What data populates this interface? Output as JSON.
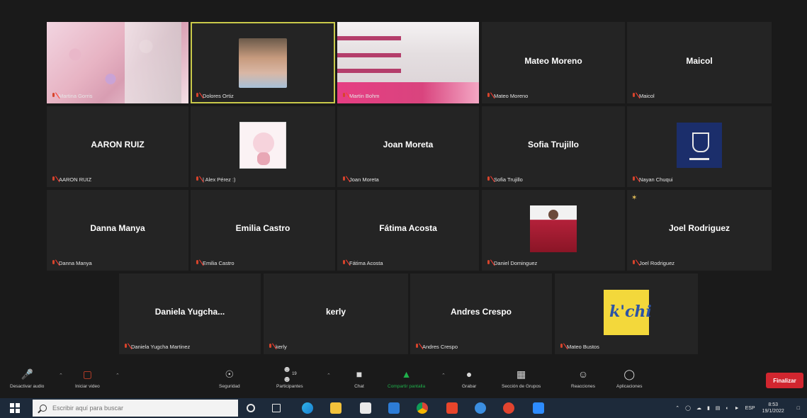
{
  "participants": [
    {
      "name": "Martina Gorris",
      "big": ""
    },
    {
      "name": "Dolores Ortiz",
      "big": ""
    },
    {
      "name": "Martin Bohm",
      "big": ""
    },
    {
      "name": "Mateo Moreno",
      "big": "Mateo Moreno"
    },
    {
      "name": "Maicol",
      "big": "Maicol"
    },
    {
      "name": "AARON RUIZ",
      "big": "AARON RUIZ"
    },
    {
      "name": "| Alex Pérez :)",
      "big": ""
    },
    {
      "name": "Joan Moreta",
      "big": "Joan Moreta"
    },
    {
      "name": "Sofia Trujillo",
      "big": "Sofia Trujillo"
    },
    {
      "name": "Nayan Chuqui",
      "big": ""
    },
    {
      "name": "Danna Manya",
      "big": "Danna Manya"
    },
    {
      "name": "Emilia Castro",
      "big": "Emilia Castro"
    },
    {
      "name": "Fátima Acosta",
      "big": "Fátima Acosta"
    },
    {
      "name": "Daniel Dominguez",
      "big": ""
    },
    {
      "name": "Joel Rodriguez",
      "big": "Joel Rodriguez"
    },
    {
      "name": "Daniela Yugcha Martinez",
      "big": "Daniela Yugcha..."
    },
    {
      "name": "kerly",
      "big": "kerly"
    },
    {
      "name": "Andres Crespo",
      "big": "Andres Crespo"
    },
    {
      "name": "Mateo Bustos",
      "big": ""
    }
  ],
  "toolbar": {
    "mute": "Desactivar audio",
    "video": "Iniciar video",
    "security": "Seguridad",
    "participants": "Participantes",
    "participants_count": "19",
    "chat": "Chat",
    "share": "Compartir pantalla",
    "record": "Grabar",
    "breakout": "Sección de Grupos",
    "reactions": "Reacciones",
    "apps": "Aplicaciones",
    "end": "Finalizar"
  },
  "taskbar": {
    "search_placeholder": "Escribir aquí para buscar",
    "lang": "ESP",
    "time": "8:53",
    "date": "19/1/2022"
  },
  "colors": {
    "active_border": "#c9c94a",
    "end_button": "#d1262f",
    "share_green": "#1fb04b"
  }
}
